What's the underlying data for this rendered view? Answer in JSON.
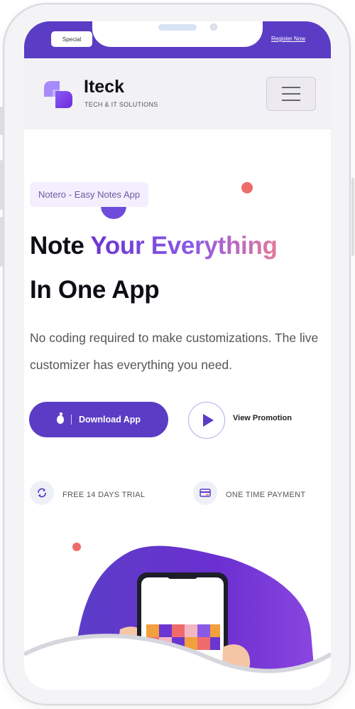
{
  "topbar": {
    "badge": "Special",
    "link": "Register Now"
  },
  "header": {
    "brand_name": "Iteck",
    "brand_tagline": "TECH & IT SOLUTIONS",
    "menu_icon": "hamburger-menu-icon"
  },
  "hero": {
    "chip": "Notero - Easy Notes App",
    "title_line1_plain": "Note ",
    "title_line1_highlight": "Your Everything",
    "title_line2": "In One App",
    "description": "No coding required to make customizations. The live customizer has everything you need.",
    "download_label": "Download App",
    "download_icon": "apple-icon",
    "promo_label": "View Promotion",
    "promo_icon": "play-icon"
  },
  "features": [
    {
      "icon": "refresh-icon",
      "label": "FREE 14 DAYS TRIAL"
    },
    {
      "icon": "credit-card-icon",
      "label": "ONE TIME PAYMENT"
    }
  ],
  "colors": {
    "brand_purple": "#5b3cc4",
    "accent_coral": "#ef6b6b",
    "header_bg": "#f2f1f5"
  }
}
